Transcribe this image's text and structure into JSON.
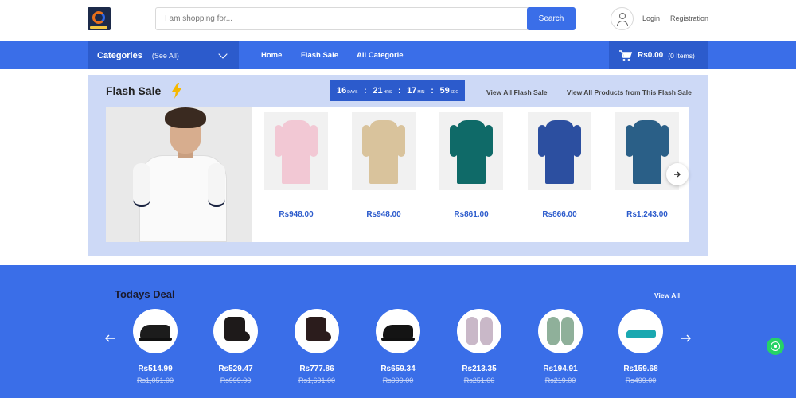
{
  "header": {
    "search_placeholder": "I am shopping for...",
    "search_button": "Search",
    "login": "Login",
    "registration": "Registration"
  },
  "nav": {
    "categories_label": "Categories",
    "see_all": "(See All)",
    "links": [
      "Home",
      "Flash Sale",
      "All Categorie"
    ],
    "cart_price": "Rs0.00",
    "cart_items": "(0 Items)"
  },
  "flash_sale": {
    "title": "Flash Sale",
    "countdown": {
      "days": "16",
      "days_label": "DAYS",
      "hrs": "21",
      "hrs_label": "HRS",
      "min": "17",
      "min_label": "MIN",
      "sec": "59",
      "sec_label": "SEC"
    },
    "view_all_link": "View All Flash Sale",
    "view_products_link": "View All Products from This Flash Sale",
    "products": [
      {
        "price": "Rs948.00",
        "color": "#f2c8d4"
      },
      {
        "price": "Rs948.00",
        "color": "#d9c39c"
      },
      {
        "price": "Rs861.00",
        "color": "#0f6a68"
      },
      {
        "price": "Rs866.00",
        "color": "#2c4fa0"
      },
      {
        "price": "Rs1,243.00",
        "color": "#2a5f87"
      }
    ]
  },
  "todays_deal": {
    "title": "Todays Deal",
    "view_all": "View All",
    "items": [
      {
        "price": "Rs514.99",
        "old_price": "Rs1,051.00",
        "kind": "shoe",
        "color": "#1c1c1c"
      },
      {
        "price": "Rs529.47",
        "old_price": "Rs999.00",
        "kind": "boot",
        "color": "#1e1a1a"
      },
      {
        "price": "Rs777.86",
        "old_price": "Rs1,691.00",
        "kind": "boot",
        "color": "#2b1c1c"
      },
      {
        "price": "Rs659.34",
        "old_price": "Rs999.00",
        "kind": "shoe",
        "color": "#141414"
      },
      {
        "price": "Rs213.35",
        "old_price": "Rs251.00",
        "kind": "sandal",
        "color": "#c9b8c8"
      },
      {
        "price": "Rs194.91",
        "old_price": "Rs219.00",
        "kind": "sandal",
        "color": "#8fb09a"
      },
      {
        "price": "Rs159.68",
        "old_price": "Rs499.00",
        "kind": "slipper",
        "color": "#1aa8b0"
      }
    ]
  },
  "colors": {
    "primary": "#3a6ee8",
    "primary_dark": "#2c5bcc",
    "flash_bg": "#cdd9f6",
    "whatsapp": "#25d366"
  }
}
